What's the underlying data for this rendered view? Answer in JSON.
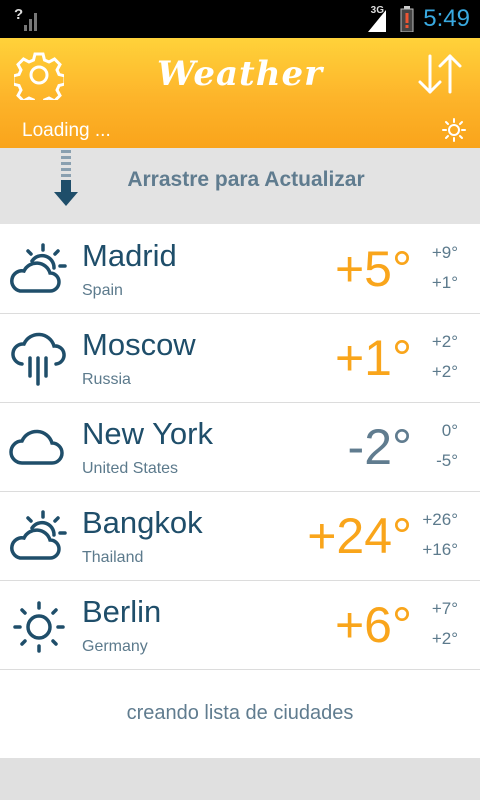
{
  "status_bar": {
    "signal_unknown": "?",
    "network": "3G",
    "time": "5:49"
  },
  "header": {
    "title": "Weather",
    "loading_text": "Loading ...",
    "accent_color": "#fdb42a"
  },
  "pull_refresh": {
    "label": "Arrastre para Actualizar"
  },
  "cities": [
    {
      "city": "Madrid",
      "country": "Spain",
      "temp": "+5°",
      "high": "+9°",
      "low": "+1°",
      "icon": "partly-cloudy-icon"
    },
    {
      "city": "Moscow",
      "country": "Russia",
      "temp": "+1°",
      "high": "+2°",
      "low": "+2°",
      "icon": "rain-icon"
    },
    {
      "city": "New York",
      "country": "United States",
      "temp": "-2°",
      "high": "0°",
      "low": "-5°",
      "icon": "cloud-icon"
    },
    {
      "city": "Bangkok",
      "country": "Thailand",
      "temp": "+24°",
      "high": "+26°",
      "low": "+16°",
      "icon": "partly-cloudy-icon"
    },
    {
      "city": "Berlin",
      "country": "Germany",
      "temp": "+6°",
      "high": "+7°",
      "low": "+2°",
      "icon": "sun-icon"
    }
  ],
  "footer": {
    "message": "creando lista de ciudades"
  },
  "colors": {
    "positive_temp": "#f9a51b",
    "negative_temp": "#607c8f",
    "city_text": "#1f4e6a"
  }
}
